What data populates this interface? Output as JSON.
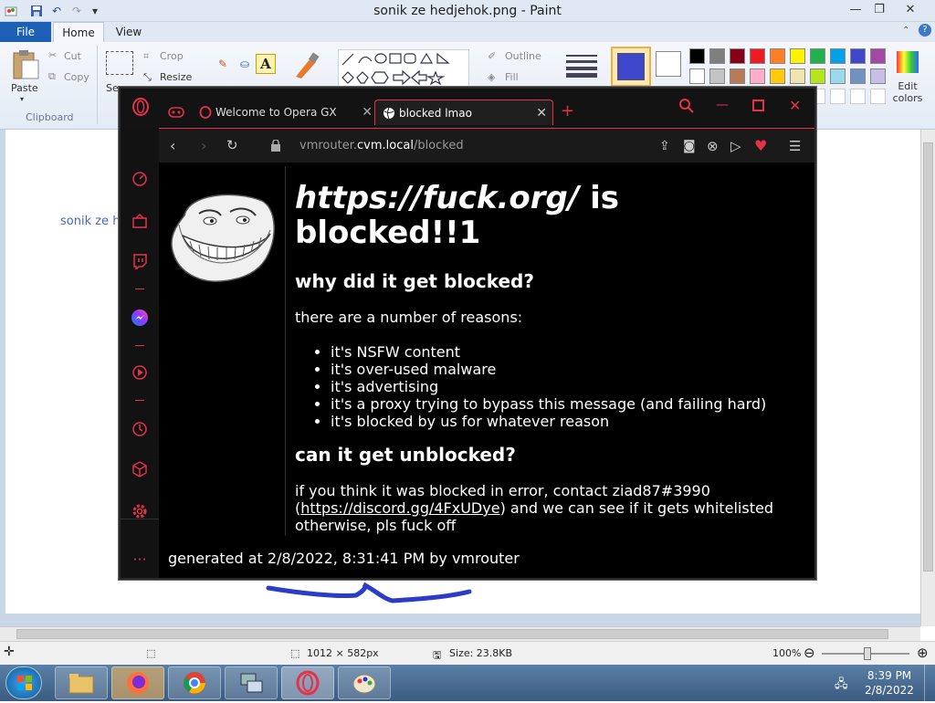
{
  "paint": {
    "title": "sonik ze hedjehok.png - Paint",
    "tabs": {
      "file": "File",
      "home": "Home",
      "view": "View"
    },
    "clipboard": {
      "paste": "Paste",
      "cut": "Cut",
      "copy": "Copy",
      "group": "Clipboard"
    },
    "image": {
      "select": "Se",
      "crop": "Crop",
      "resize": "Resize"
    },
    "shapes": {
      "outline": "Outline",
      "fill": "Fill"
    },
    "edit_colors": "Edit colors",
    "canvas_text": "sonik ze h",
    "status": {
      "dimensions": "1012 × 582px",
      "size": "Size: 23.8KB",
      "zoom": "100%"
    },
    "palette": [
      "#000000",
      "#7f7f7f",
      "#880015",
      "#ed1c24",
      "#ff7f27",
      "#fff200",
      "#22b14c",
      "#00a2e8",
      "#3f48cc",
      "#a349a4",
      "#ffffff",
      "#c3c3c3",
      "#b97a57",
      "#ffaec9",
      "#ffc90e",
      "#efe4b0",
      "#b5e61d",
      "#99d9ea",
      "#7092be",
      "#c8bfe7"
    ],
    "color1": "#3f48cc",
    "color2": "#ffffff"
  },
  "opera": {
    "tabs": [
      {
        "label": "Welcome to Opera GX"
      },
      {
        "label": "blocked lmao"
      }
    ],
    "address": {
      "host_pre": "vmrouter.",
      "host_bold": "cvm.local",
      "path": "/blocked"
    },
    "page": {
      "title_url": "https://fuck.org/",
      "title_rest": " is blocked!!1",
      "h_why": "why did it get blocked?",
      "intro": "there are a number of reasons:",
      "reasons": [
        "it's NSFW content",
        "it's over-used malware",
        "it's advertising",
        "it's a proxy trying to bypass this message (and failing hard)",
        "it's blocked by us for whatever reason"
      ],
      "h_unblock": "can it get unblocked?",
      "contact_1": "if you think it was blocked in error, contact ziad87#3990",
      "contact_paren_open": "(",
      "contact_link": "https://discord.gg/4FxUDye",
      "contact_2": ") and we can see if it gets whitelisted",
      "contact_3": "otherwise, pls fuck off",
      "generated": "generated at 2/8/2022, 8:31:41 PM by vmrouter"
    }
  },
  "taskbar": {
    "time": "8:39 PM",
    "date": "2/8/2022"
  },
  "colors": {
    "opera_accent": "#e5324a",
    "paint_blue": "#1d5fb4"
  }
}
